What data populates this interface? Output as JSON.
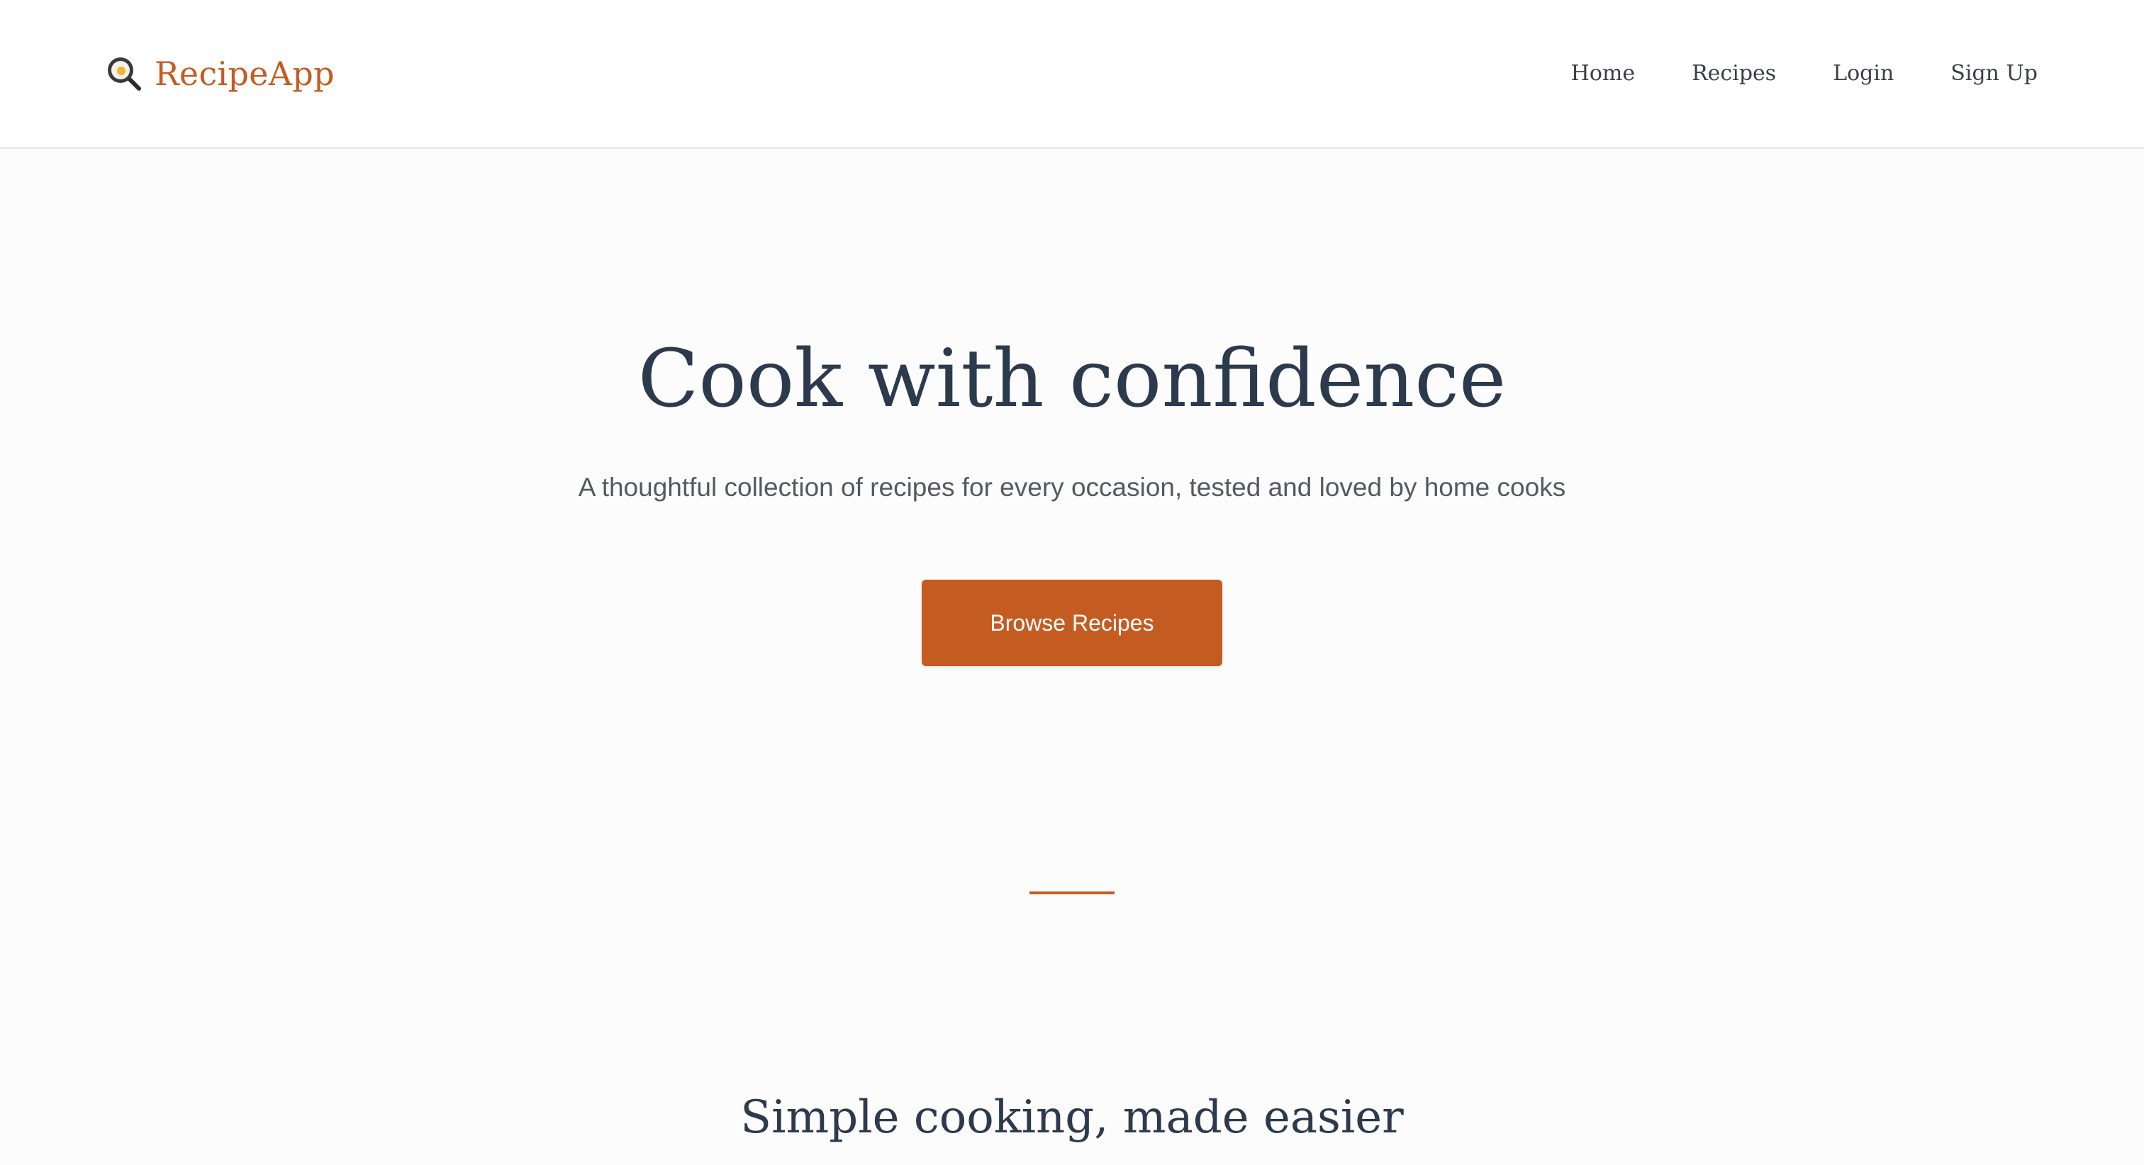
{
  "brand": {
    "icon": "frying-pan-egg-icon",
    "name": "RecipeApp",
    "color": "#c45c22"
  },
  "nav": {
    "items": [
      {
        "label": "Home"
      },
      {
        "label": "Recipes"
      },
      {
        "label": "Login"
      },
      {
        "label": "Sign Up"
      }
    ]
  },
  "hero": {
    "title": "Cook with confidence",
    "subtitle": "A thoughtful collection of recipes for every occasion, tested and loved by home cooks",
    "cta_label": "Browse Recipes"
  },
  "section": {
    "title": "Simple cooking, made easier"
  },
  "colors": {
    "accent": "#c45c22",
    "heading": "#2c3a4d",
    "background": "#fdfcfc"
  }
}
